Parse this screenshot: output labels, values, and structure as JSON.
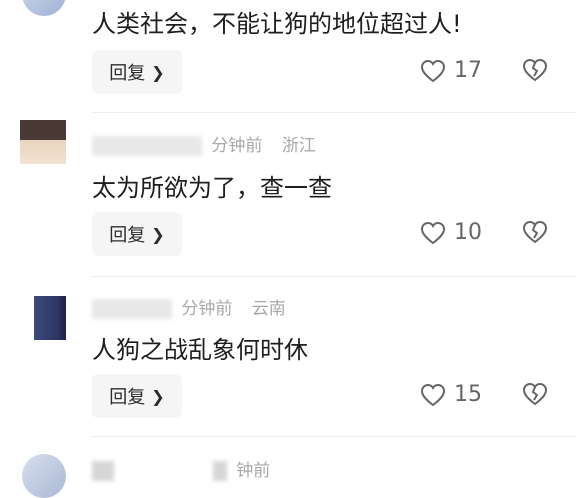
{
  "colors": {
    "accent": "#222222",
    "meta": "#a8a8a8",
    "button_bg": "#f5f5f5"
  },
  "comments": [
    {
      "meta_time": "",
      "meta_location": "",
      "text": "人类社会，不能让狗的地位超过人!",
      "reply_label": "回复",
      "likes": "17"
    },
    {
      "meta_time": "分钟前",
      "meta_location": "浙江",
      "text": "太为所欲为了，查一查",
      "reply_label": "回复",
      "likes": "10"
    },
    {
      "meta_time": "分钟前",
      "meta_location": "云南",
      "text": "人狗之战乱象何时休",
      "reply_label": "回复",
      "likes": "15"
    },
    {
      "meta_time": "钟前",
      "meta_location": "",
      "text": "",
      "reply_label": "",
      "likes": ""
    }
  ]
}
